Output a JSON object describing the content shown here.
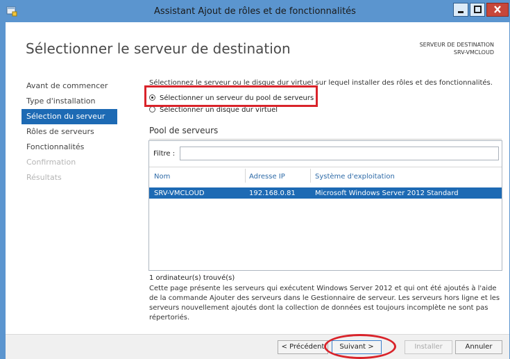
{
  "window": {
    "title": "Assistant Ajout de rôles et de fonctionnalités",
    "accent_color": "#5b95cf",
    "icons": [
      "app-icon",
      "minimize-icon",
      "maximize-icon",
      "close-icon"
    ]
  },
  "header": {
    "page_title": "Sélectionner le serveur de destination",
    "dest_label": "SERVEUR DE DESTINATION",
    "dest_server": "SRV-VMCLOUD"
  },
  "nav": {
    "items": [
      {
        "label": "Avant de commencer",
        "state": "normal"
      },
      {
        "label": "Type d'installation",
        "state": "normal"
      },
      {
        "label": "Sélection du serveur",
        "state": "active"
      },
      {
        "label": "Rôles de serveurs",
        "state": "normal"
      },
      {
        "label": "Fonctionnalités",
        "state": "normal"
      },
      {
        "label": "Confirmation",
        "state": "disabled"
      },
      {
        "label": "Résultats",
        "state": "disabled"
      }
    ]
  },
  "content": {
    "instruction": "Sélectionnez le serveur ou le disque dur virtuel sur lequel installer des rôles et des fonctionnalités.",
    "options": [
      {
        "label": "Sélectionner un serveur du pool de serveurs",
        "selected": true
      },
      {
        "label": "Sélectionner un disque dur virtuel",
        "selected": false
      }
    ],
    "pool_label": "Pool de serveurs",
    "filter_label": "Filtre :",
    "filter_value": "",
    "columns": [
      "Nom",
      "Adresse IP",
      "Système d'exploitation"
    ],
    "rows": [
      {
        "name": "SRV-VMCLOUD",
        "ip": "192.168.0.81",
        "os": "Microsoft Windows Server 2012 Standard",
        "selected": true
      }
    ],
    "count": "1 ordinateur(s) trouvé(s)",
    "description": "Cette page présente les serveurs qui exécutent Windows Server 2012 et qui ont été ajoutés à l'aide de la commande Ajouter des serveurs dans le Gestionnaire de serveur. Les serveurs hors ligne et les serveurs nouvellement ajoutés dont la collection de données est toujours incomplète ne sont pas répertoriés."
  },
  "footer": {
    "prev": "< Précédent",
    "next": "Suivant >",
    "install": "Installer",
    "cancel": "Annuler"
  },
  "annotations": {
    "highlight_color": "#d9232a"
  }
}
